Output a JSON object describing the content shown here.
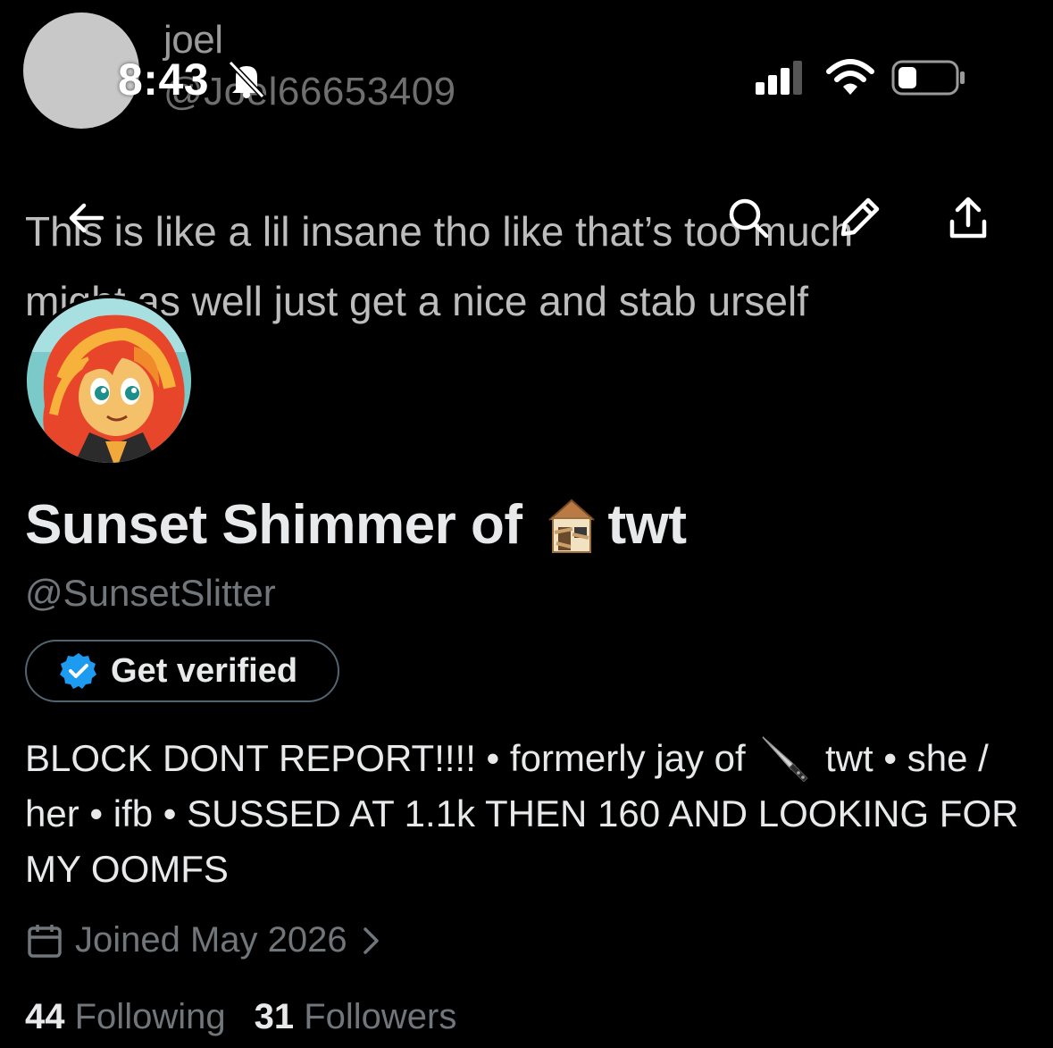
{
  "status_bar": {
    "time": "8:43",
    "icons": [
      "bell-slash-icon",
      "signal-icon",
      "wifi-icon",
      "battery-icon"
    ]
  },
  "banner": {
    "name": "joel",
    "handle": "@Joel66653409",
    "tweet_line1": "This is like a lil insane tho like that’s too much",
    "tweet_line2": "might as well just get a nice and stab urself"
  },
  "nav": {
    "icons": [
      "back-arrow-icon",
      "search-icon",
      "pencil-icon",
      "share-icon"
    ]
  },
  "profile": {
    "display_name": "Sunset Shimmer of",
    "display_name_suffix": "twt",
    "name_emoji": "boarded-house-icon",
    "handle": "@SunsetSlitter",
    "verify_label": "Get verified",
    "bio_part1": "BLOCK DONT REPORT!!!! • formerly jay of",
    "bio_emoji": "knife-icon",
    "bio_part2": "twt • she / her • ifb • SUSSED AT 1.1k THEN 160 AND LOOKING FOR MY OOMFS",
    "joined": "Joined May 2026",
    "following_count": "44",
    "following_label": "Following",
    "followers_count": "31",
    "followers_label": "Followers"
  },
  "colors": {
    "background": "#000000",
    "text": "#e7e9ea",
    "muted": "#71767b",
    "verified_blue": "#1d9bf0"
  }
}
